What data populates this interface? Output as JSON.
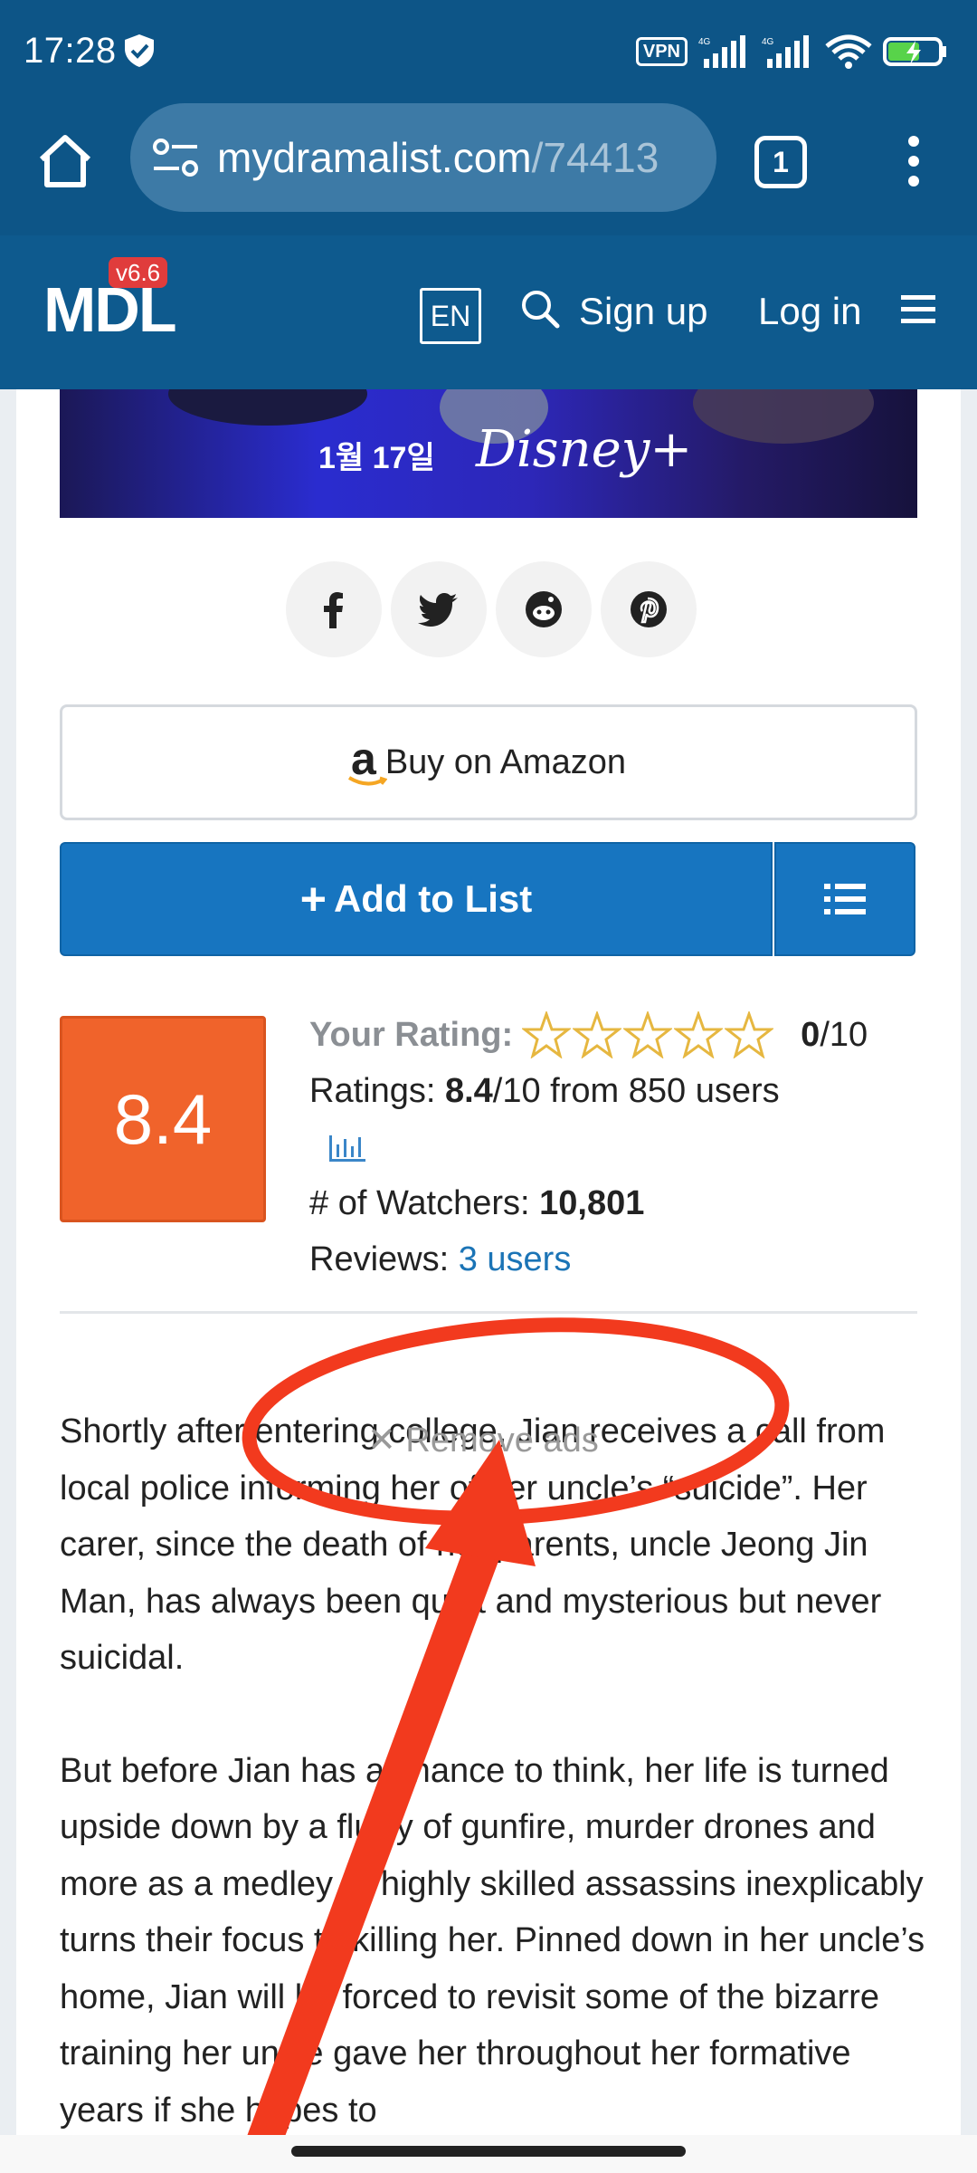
{
  "status_bar": {
    "time": "17:28",
    "vpn": "VPN",
    "battery_icon": "battery-charging-icon",
    "wifi_icon": "wifi-icon"
  },
  "browser": {
    "url_main": "mydramalist.com",
    "url_path": "/74413",
    "tab_count": "1"
  },
  "header": {
    "logo": "MDL",
    "version": "v6.6",
    "lang": "EN",
    "signup": "Sign up",
    "login": "Log in"
  },
  "banner": {
    "date": "1월 17일",
    "brand": "Disney+"
  },
  "actions": {
    "amazon_logo": "a",
    "amazon_label": "Buy on Amazon",
    "add_plus": "+",
    "add_label": "Add to List"
  },
  "rating": {
    "score": "8.4",
    "your_rating_label": "Your Rating:",
    "your_rating_value": "0",
    "your_rating_max": "/10",
    "ratings_label": "Ratings:",
    "ratings_value": "8.4",
    "ratings_rest": "/10 from 850 users",
    "watchers_label": "# of Watchers:",
    "watchers_value": "10,801",
    "reviews_label": "Reviews:",
    "reviews_link": "3 users",
    "stars_filled": 0,
    "stars_total": 5
  },
  "ads": {
    "remove": "Remove ads"
  },
  "synopsis": {
    "p1": "Shortly after entering college, Jian receives a call from local police informing her of her uncle’s “suicide”. Her carer, since the death of her parents, uncle Jeong Jin Man, has always been quiet and mysterious but never suicidal.",
    "p2": "But before Jian has a chance to think, her life is turned upside down by a flurry of gunfire, murder drones and more as a medley of highly skilled assassins inexplicably turns their focus to killing her. Pinned down in her uncle’s home, Jian will be forced to revisit some of the bizarre training her uncle gave her throughout her formative years if she hopes to"
  },
  "colors": {
    "brand_blue": "#0e5a8e",
    "button_blue": "#1775c0",
    "score_orange": "#f0632b",
    "annotation_red": "#f23a1e",
    "link_blue": "#1b74b6"
  }
}
